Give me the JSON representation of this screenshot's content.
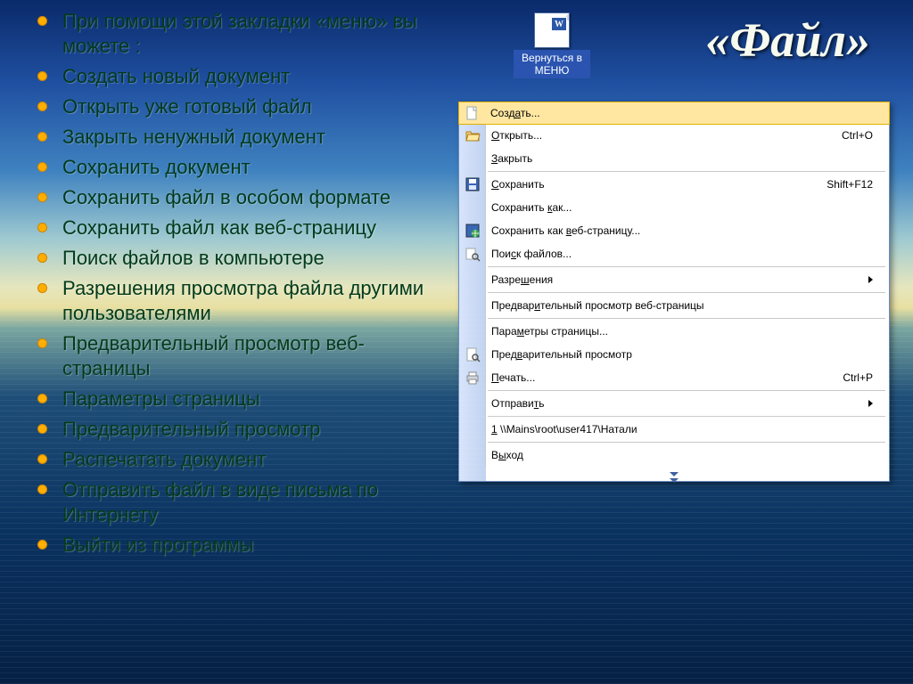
{
  "title": "«Файл»",
  "return_button": {
    "caption_line1": "Вернуться в",
    "caption_line2": "МЕНЮ",
    "badge": "W"
  },
  "bullets": [
    "При помощи этой закладки «меню» вы можете :",
    "Создать новый документ",
    "Открыть уже готовый файл",
    "Закрыть ненужный документ",
    "Сохранить документ",
    "Сохранить файл в особом формате",
    "Сохранить файл как веб-страницу",
    "Поиск файлов в компьютере",
    "Разрешения просмотра файла другими пользователями",
    "Предварительный просмотр веб-страницы",
    "Параметры страницы",
    "Предварительный просмотр",
    "Распечатать документ",
    "Отправить файл в виде письма по Интернету",
    "Выйти из программы"
  ],
  "menu_items": [
    {
      "icon": "new",
      "label": "Создать...",
      "shortcut": "",
      "submenu": false,
      "selected": true
    },
    {
      "icon": "open",
      "label": "Открыть...",
      "shortcut": "Ctrl+O",
      "submenu": false
    },
    {
      "icon": "",
      "label": "Закрыть",
      "shortcut": "",
      "submenu": false
    },
    {
      "separator": true
    },
    {
      "icon": "save",
      "label": "Сохранить",
      "shortcut": "Shift+F12",
      "submenu": false
    },
    {
      "icon": "",
      "label": "Сохранить как...",
      "shortcut": "",
      "submenu": false
    },
    {
      "icon": "saveweb",
      "label": "Сохранить как веб-страницу...",
      "shortcut": "",
      "submenu": false
    },
    {
      "icon": "search",
      "label": "Поиск файлов...",
      "shortcut": "",
      "submenu": false
    },
    {
      "separator": true
    },
    {
      "icon": "",
      "label": "Разрешения",
      "shortcut": "",
      "submenu": true
    },
    {
      "separator": true
    },
    {
      "icon": "",
      "label": "Предварительный просмотр веб-страницы",
      "shortcut": "",
      "submenu": false
    },
    {
      "separator": true
    },
    {
      "icon": "",
      "label": "Параметры страницы...",
      "shortcut": "",
      "submenu": false
    },
    {
      "icon": "preview",
      "label": "Предварительный просмотр",
      "shortcut": "",
      "submenu": false
    },
    {
      "icon": "print",
      "label": "Печать...",
      "shortcut": "Ctrl+P",
      "submenu": false
    },
    {
      "separator": true
    },
    {
      "icon": "",
      "label": "Отправить",
      "shortcut": "",
      "submenu": true
    },
    {
      "separator": true
    },
    {
      "icon": "",
      "label": "1 \\\\Mains\\root\\user417\\Натали",
      "shortcut": "",
      "submenu": false
    },
    {
      "separator": true
    },
    {
      "icon": "",
      "label": "Выход",
      "shortcut": "",
      "submenu": false
    }
  ],
  "menu_underline_map": {
    "Создать...": 4,
    "Открыть...": 0,
    "Закрыть": 0,
    "Сохранить": 0,
    "Сохранить как...": 10,
    "Сохранить как веб-страницу...": 14,
    "Поиск файлов...": 3,
    "Разрешения": 5,
    "Предварительный просмотр веб-страницы": 7,
    "Параметры страницы...": 4,
    "Предварительный просмотр": 4,
    "Печать...": 0,
    "Отправить": 7,
    "1 \\\\Mains\\root\\user417\\Натали": 0,
    "Выход": 1
  }
}
